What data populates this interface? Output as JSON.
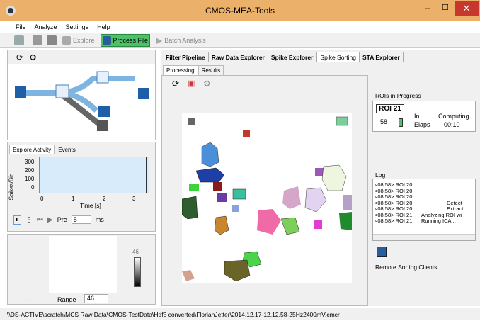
{
  "window": {
    "title": "CMOS-MEA-Tools"
  },
  "menu": {
    "items": [
      "File",
      "Analyze",
      "Settings",
      "Help"
    ]
  },
  "toolbar": {
    "explore": "Explore",
    "process_file": "Process File",
    "batch": "Batch Analysis"
  },
  "tabs": {
    "items": [
      "Filter Pipeline",
      "Raw Data Explorer",
      "Spike Explorer",
      "Spike Sorting",
      "STA Explorer"
    ],
    "selected": "Spike Sorting"
  },
  "subtabs": {
    "processing": "Processing",
    "results": "Results"
  },
  "explore": {
    "tab_activity": "Explore Activity",
    "tab_events": "Events",
    "ylabel": "Spikes/Bin",
    "xlabel": "Time [s]",
    "yticks": [
      "300",
      "200",
      "100",
      "0"
    ],
    "xticks": [
      "0",
      "1",
      "2",
      "3"
    ],
    "pre_label": "Pre",
    "pre_value": "5",
    "ms": "ms"
  },
  "bottom": {
    "max": "46",
    "dash": "---",
    "range_label": "Range",
    "range_value": "46"
  },
  "roi": {
    "section": "ROIs in Progress",
    "name": "ROI 21",
    "count": "58",
    "in": "In",
    "elaps": "Elaps",
    "state": "Computing",
    "time": "00:10"
  },
  "log": {
    "title": "Log",
    "lines": [
      "<08:58> ROI 20:",
      "<08:58> ROI 20:",
      "<08:58> ROI 20:",
      "<08:58> ROI 20:",
      "<08:58> ROI 20:",
      "<08:58> ROI 21:",
      "<08:58> ROI 21:"
    ],
    "right": [
      "",
      "",
      "",
      "Detect",
      "Extract",
      "Analyzing ROI wi",
      "Running ICA..."
    ]
  },
  "remote": {
    "title": "Remote Sorting Clients"
  },
  "status": {
    "path": "\\\\DS-ACTIVE\\scratch\\MCS Raw Data\\CMOS-TestData\\Hdf5 converted\\FlorianJetter\\2014.12.17-12.12.58-25Hz2400mV.cmcr"
  },
  "colors": {
    "titlebar": "#ebb16a",
    "close": "#c7372e",
    "accent": "#4fc06a",
    "pipeline": "#7fb4e0"
  }
}
